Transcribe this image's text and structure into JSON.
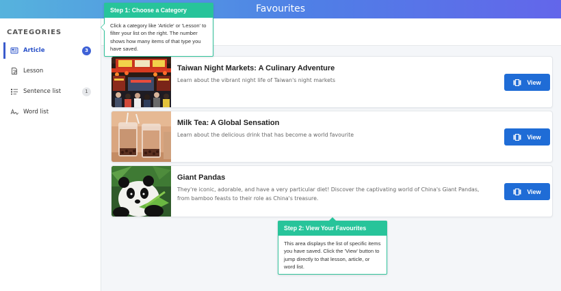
{
  "header": {
    "title": "Favourites"
  },
  "sidebar": {
    "heading": "CATEGORIES",
    "items": [
      {
        "label": "Article",
        "count": "3",
        "icon": "article-icon",
        "active": true
      },
      {
        "label": "Lesson",
        "count": "",
        "icon": "lesson-icon",
        "active": false
      },
      {
        "label": "Sentence list",
        "count": "1",
        "icon": "sentence-list-icon",
        "active": false
      },
      {
        "label": "Word list",
        "count": "",
        "icon": "word-list-icon",
        "active": false
      }
    ]
  },
  "cards": [
    {
      "title": "Taiwan Night Markets: A Culinary Adventure",
      "desc": "Learn about the vibrant night life of Taiwan's night markets",
      "button": "View",
      "thumb": "night-market-image"
    },
    {
      "title": "Milk Tea: A Global Sensation",
      "desc": "Learn about the delicious drink that has become a world favourite",
      "button": "View",
      "thumb": "milk-tea-image"
    },
    {
      "title": "Giant Pandas",
      "desc": "They're iconic, adorable, and have a very particular diet! Discover the captivating world of China's Giant Pandas, from bamboo feasts to their role as China's treasure.",
      "button": "View",
      "thumb": "giant-panda-image"
    }
  ],
  "tooltips": {
    "step1": {
      "title": "Step 1: Choose a Category",
      "body": "Click a category like 'Article' or 'Lesson' to filter your list on the right. The number shows how many items of that type you have saved."
    },
    "step2": {
      "title": "Step 2: View Your Favourites",
      "body": "This area displays the list of specific items you have saved. Click the 'View' button to jump directly to that lesson, article, or word list."
    }
  },
  "colors": {
    "accent": "#1f6cd6",
    "active": "#3a5bcc",
    "tooltip": "#27c49a",
    "header_start": "#56b3dd",
    "header_end": "#6366ea"
  }
}
